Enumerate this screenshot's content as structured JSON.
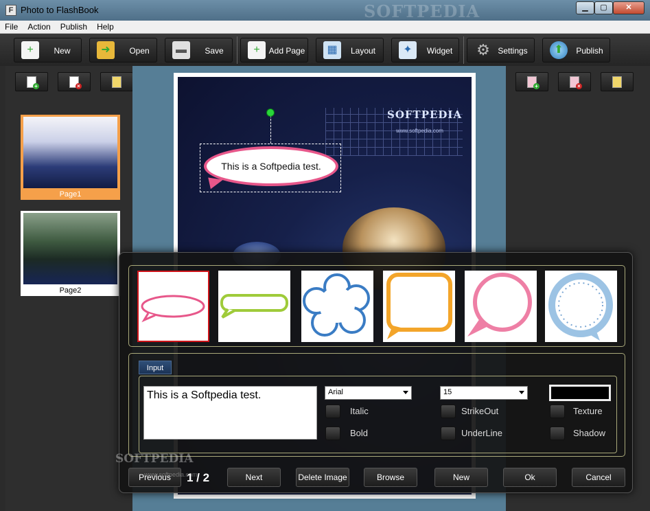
{
  "window": {
    "title": "Photo to FlashBook",
    "watermark": "SOFTPEDIA",
    "min": "▁",
    "max": "▢",
    "close": "✕"
  },
  "menu": [
    "File",
    "Action",
    "Publish",
    "Help"
  ],
  "toolbar": {
    "new": "New",
    "open": "Open",
    "save": "Save",
    "add_page": "Add Page",
    "layout": "Layout",
    "widget": "Widget",
    "settings": "Settings",
    "publish": "Publish"
  },
  "pages": [
    {
      "label": "Page1",
      "selected": true
    },
    {
      "label": "Page2",
      "selected": false
    }
  ],
  "canvas": {
    "bubble_text": "This is a Softpedia test.",
    "brand": "SOFTPEDIA",
    "brand_url": "www.softpedia.com"
  },
  "dialog": {
    "tab": "Input",
    "text_value": "This is a Softpedia test.",
    "font": "Arial",
    "size": "15",
    "checkboxes": {
      "italic": "Italic",
      "bold": "Bold",
      "strikeout": "StrikeOut",
      "underline": "UnderLine",
      "texture": "Texture",
      "shadow": "Shadow"
    },
    "page_indicator": "1 / 2",
    "buttons": {
      "previous": "Previous",
      "next": "Next",
      "delete_image": "Delete Image",
      "browse": "Browse",
      "new": "New",
      "ok": "Ok",
      "cancel": "Cancel"
    },
    "watermark": "SOFTPEDIA",
    "watermark_url": "www.softpedia.com"
  },
  "colors": {
    "selected_page": "#f5a04a",
    "bubble_border": "#e7578a",
    "accent_green": "#29d63a"
  }
}
